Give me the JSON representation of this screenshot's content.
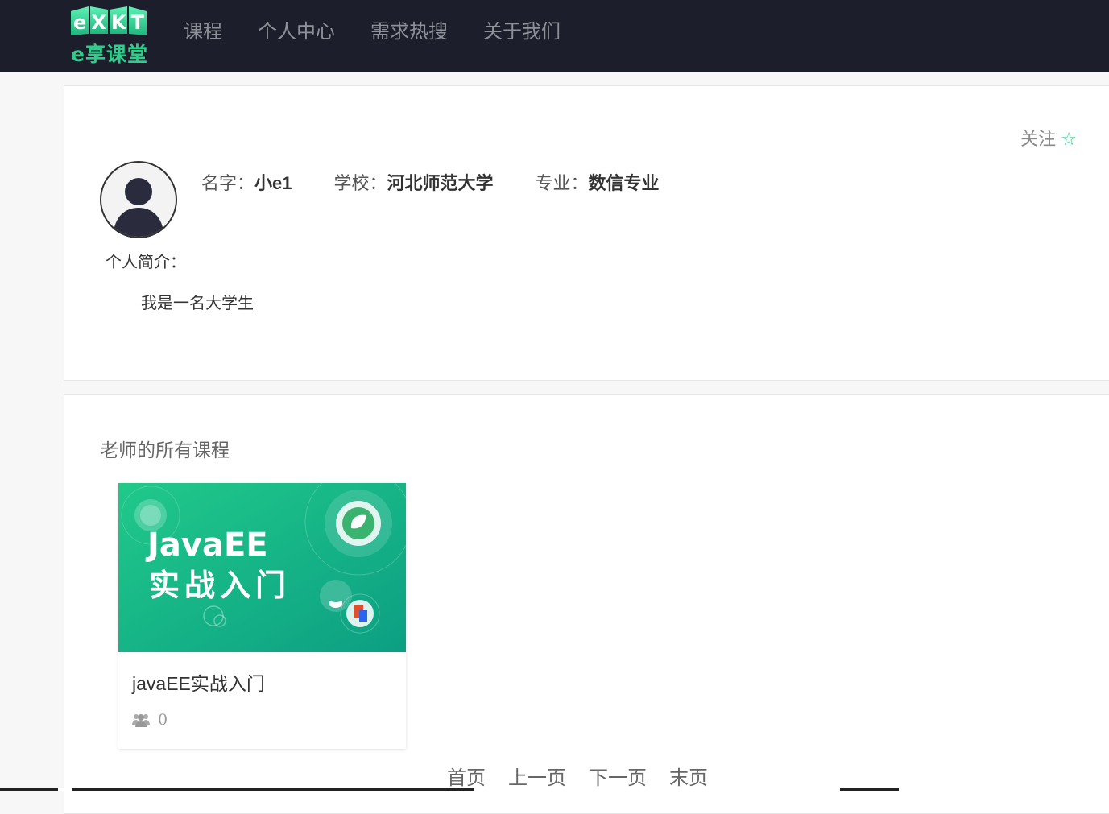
{
  "header": {
    "logo_text": "e享课堂",
    "logo_letters": "eXKT",
    "nav": [
      "课程",
      "个人中心",
      "需求热搜",
      "关于我们"
    ]
  },
  "profile": {
    "follow_label": "关注",
    "follow_icon": "star-outline-icon",
    "name_label": "名字：",
    "name_value": "小e1",
    "school_label": "学校：",
    "school_value": "河北师范大学",
    "major_label": "专业：",
    "major_value": "数信专业",
    "intro_label": "个人简介：",
    "intro_text": "我是一名大学生"
  },
  "courses": {
    "section_title": "老师的所有课程",
    "items": [
      {
        "title": "javaEE实战入门",
        "cover_line1": "JavaEE",
        "cover_line2": "实战入门",
        "students": "0",
        "students_icon": "users-icon"
      }
    ]
  },
  "pager": {
    "first": "首页",
    "prev": "上一页",
    "next": "下一页",
    "last": "末页"
  },
  "colors": {
    "accent": "#2fcd8a",
    "header_bg": "#1c1f2b",
    "cover_gradient_start": "#1fc98a",
    "cover_gradient_end": "#0e9f82"
  }
}
